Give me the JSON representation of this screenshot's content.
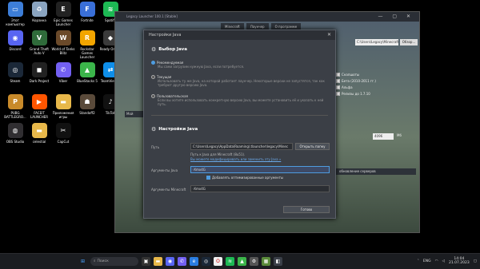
{
  "desktop": {
    "icons": [
      {
        "label": "Этот компьютер",
        "icon": "computer-icon",
        "color": "#3d7ed8"
      },
      {
        "label": "Корзина",
        "icon": "recycle-bin-icon",
        "color": "#8aa4c0"
      },
      {
        "label": "Epic Games Launcher",
        "icon": "epic-games-icon",
        "color": "#222222"
      },
      {
        "label": "Fortnite",
        "icon": "fortnite-icon",
        "color": "#3a6fd8"
      },
      {
        "label": "Spotify",
        "icon": "spotify-icon",
        "color": "#1db954"
      },
      {
        "label": "Discord",
        "icon": "discord-icon",
        "color": "#5865f2"
      },
      {
        "label": "Grand Theft Auto V",
        "icon": "gta-icon",
        "color": "#2f6b3a"
      },
      {
        "label": "World of Tanks Blitz",
        "icon": "wot-icon",
        "color": "#6b4a2a"
      },
      {
        "label": "Rockstar Games Launcher",
        "icon": "rockstar-icon",
        "color": "#f2a500"
      },
      {
        "label": "Ready Or Not",
        "icon": "ready-or-not-icon",
        "color": "#3a3a3a"
      },
      {
        "label": "Steam",
        "icon": "steam-icon",
        "color": "#1b2838"
      },
      {
        "label": "Dark Project",
        "icon": "dark-project-icon",
        "color": "#222222"
      },
      {
        "label": "Viber",
        "icon": "viber-icon",
        "color": "#7360f2"
      },
      {
        "label": "BlueStacks 5",
        "icon": "bluestacks-icon",
        "color": "#3bb54a"
      },
      {
        "label": "TeamViewer",
        "icon": "teamviewer-icon",
        "color": "#0e8ee9"
      },
      {
        "label": "PUBG BATTLEGRO...",
        "icon": "pubg-icon",
        "color": "#c88a2a"
      },
      {
        "label": "FACEIT LAUNCHER",
        "icon": "faceit-icon",
        "color": "#ff5500"
      },
      {
        "label": "Приложения игры",
        "icon": "folder-icon",
        "color": "#e8b84a"
      },
      {
        "label": "Standoff2",
        "icon": "standoff-icon",
        "color": "#5a4a3a"
      },
      {
        "label": "TikTok",
        "icon": "tiktok-icon",
        "color": "#111111"
      },
      {
        "label": "OBS Studio",
        "icon": "obs-icon",
        "color": "#302e31"
      },
      {
        "label": "celestial",
        "icon": "folder-icon",
        "color": "#e8b84a"
      },
      {
        "label": "CapCut",
        "icon": "capcut-icon",
        "color": "#111111"
      }
    ]
  },
  "launcher": {
    "title": "Legacy Launcher 100.1 [Stable]",
    "tabs": [
      "Minecraft",
      "Лаунчер",
      "О программе"
    ],
    "game_dir": "C:\\Users\\Legacy\\Minecraft\\game",
    "browse_label": "Обзор...",
    "versions": [
      "Снапшоты",
      "Бета (2010-2011 гг.)",
      "Альфа",
      "Релизы до 1.7.10"
    ],
    "memory_value": "4096",
    "memory_unit": "Мб",
    "left_item": "Мой",
    "group_label": "обновление серверов"
  },
  "dialog": {
    "title": "Настройки Java",
    "section1": "Выбор Java",
    "opt_recommended": "Рекомендуемая",
    "opt_recommended_desc": "Мы сами загрузим нужную Java, если потребуется.",
    "opt_current": "Текущая",
    "opt_current_desc": "Использовать ту же Java, на которой работает лаунчер. Некоторые версии не запустятся, так как требуют другую версию Java.",
    "opt_custom": "Пользовательская",
    "opt_custom_desc": "Если вы хотите использовать конкретную версию Java, вы можете установить её и указать к ней путь.",
    "section2": "Настройки Java",
    "path_label": "Путь",
    "path_value": "C:\\Users\\Legacy\\AppData\\Roaming\\.tlauncher\\legacy\\Minec",
    "open_folder": "Открыть папку",
    "path_hint": "Путь к Java для Minecraft (8u51).",
    "path_link": "Вы можете модифицировать или заменить эту Java »",
    "jvm_label": "Аргументы Java",
    "jvm_value": "-Xmx4G",
    "chk_optimized": "Добавлять оптимизированные аргументы",
    "mc_label": "Аргументы Minecraft",
    "mc_value": "-Xmx4G",
    "done": "Готово"
  },
  "taskbar": {
    "search_placeholder": "Поиск",
    "lang": "ENG",
    "time": "14:04",
    "date": "21.07.2023"
  }
}
